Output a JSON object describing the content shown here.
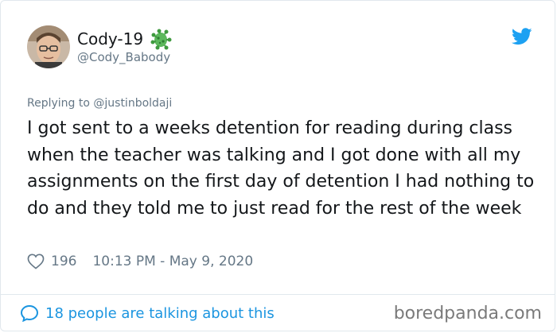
{
  "author": {
    "name": "Cody-19",
    "handle": "@Cody_Babody"
  },
  "reply": {
    "prefix": "Replying to ",
    "mention": "@justinboldaji"
  },
  "tweet": {
    "text": "I got sent to a weeks detention for reading during class when the teacher was talking and I got done with all my assignments on the first day of detention I had nothing to do and they told me to just read for the rest of the week",
    "likes": "196",
    "timestamp": "10:13 PM - May 9, 2020"
  },
  "footer": {
    "talking": "18 people are talking about this",
    "watermark": "boredpanda.com"
  },
  "colors": {
    "twitter_blue": "#1da1f2",
    "link_blue": "#1b95e0",
    "muted": "#657786",
    "virus_green": "#4caf50"
  },
  "icons": [
    "virus-emoji-icon",
    "twitter-bird-icon",
    "heart-icon",
    "speech-bubble-icon"
  ]
}
